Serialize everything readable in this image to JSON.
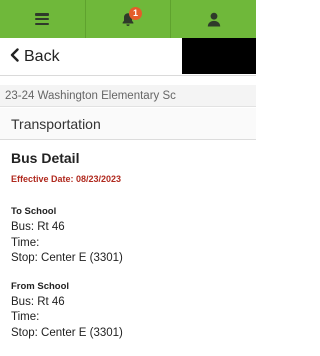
{
  "topbar": {
    "menu_icon": "menu-icon",
    "bell_icon": "bell-icon",
    "notification_count": "1",
    "user_icon": "user-icon",
    "color": "#6fb83a",
    "badge_color": "#e45c2a"
  },
  "nav": {
    "back_label": "Back",
    "back_icon": "chevron-left-icon"
  },
  "org_name": "23-24 Washington Elementary Sc",
  "section_title": "Transportation",
  "detail": {
    "title": "Bus Detail",
    "effective_date": "Effective Date: 08/23/2023",
    "to_school": {
      "heading": "To School",
      "bus": "Bus: Rt 46",
      "time": "Time:",
      "stop": "Stop: Center E (3301)"
    },
    "from_school": {
      "heading": "From School",
      "bus": "Bus: Rt 46",
      "time": "Time:",
      "stop": "Stop: Center E (3301)"
    }
  }
}
